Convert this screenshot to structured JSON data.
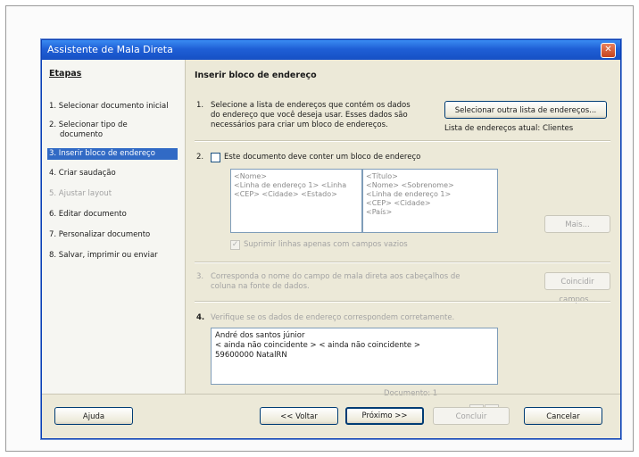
{
  "window": {
    "title": "Assistente de Mala Direta",
    "close": "✕"
  },
  "steps": {
    "title": "Etapas",
    "items": [
      "1. Selecionar documento inicial",
      "2. Selecionar tipo de",
      "documento",
      "3. Inserir bloco de endereço",
      "4. Criar saudação",
      "5. Ajustar layout",
      "6. Editar documento",
      "7. Personalizar documento",
      "8. Salvar, imprimir ou enviar"
    ]
  },
  "main": {
    "title": "Inserir bloco de endereço",
    "step1": {
      "num": "1.",
      "lines": [
        "Selecione a lista de endereços que contém os dados",
        "do endereço que você deseja usar. Esses dados são",
        "necessários para criar um bloco de endereços."
      ],
      "button": "Selecionar outra lista de endereços...",
      "current_list": "Lista de endereços atual: Clientes"
    },
    "step2": {
      "num": "2.",
      "checkbox_label": "Este documento deve conter um bloco de endereço",
      "preview_left": [
        "<Nome>",
        "<Linha de endereço 1> <Linha",
        "<CEP> <Cidade> <Estado>"
      ],
      "preview_right": [
        "<Título>",
        "<Nome> <Sobrenome>",
        "<Linha de endereço 1>",
        "<CEP> <Cidade>",
        "<País>"
      ],
      "more_button": "Mais...",
      "suppress_label": "Suprimir linhas apenas com campos vazios"
    },
    "step3": {
      "num": "3.",
      "lines": [
        "Corresponda o nome do campo de mala direta aos cabeçalhos de",
        "coluna na fonte de dados."
      ],
      "button": "Coincidir campos..."
    },
    "step4": {
      "num": "4.",
      "label": "Verifique se os dados de endereço correspondem corretamente.",
      "address": [
        "André dos santos júnior",
        "< ainda não coincidente > < ainda não coincidente >",
        "59600000 NatalRN"
      ],
      "doc_label": "Documento: 1",
      "prev": "◀",
      "next": "▶"
    }
  },
  "buttons": {
    "help": "Ajuda",
    "back": "<< Voltar",
    "next": "Próximo >>",
    "finish": "Concluir",
    "cancel": "Cancelar"
  }
}
